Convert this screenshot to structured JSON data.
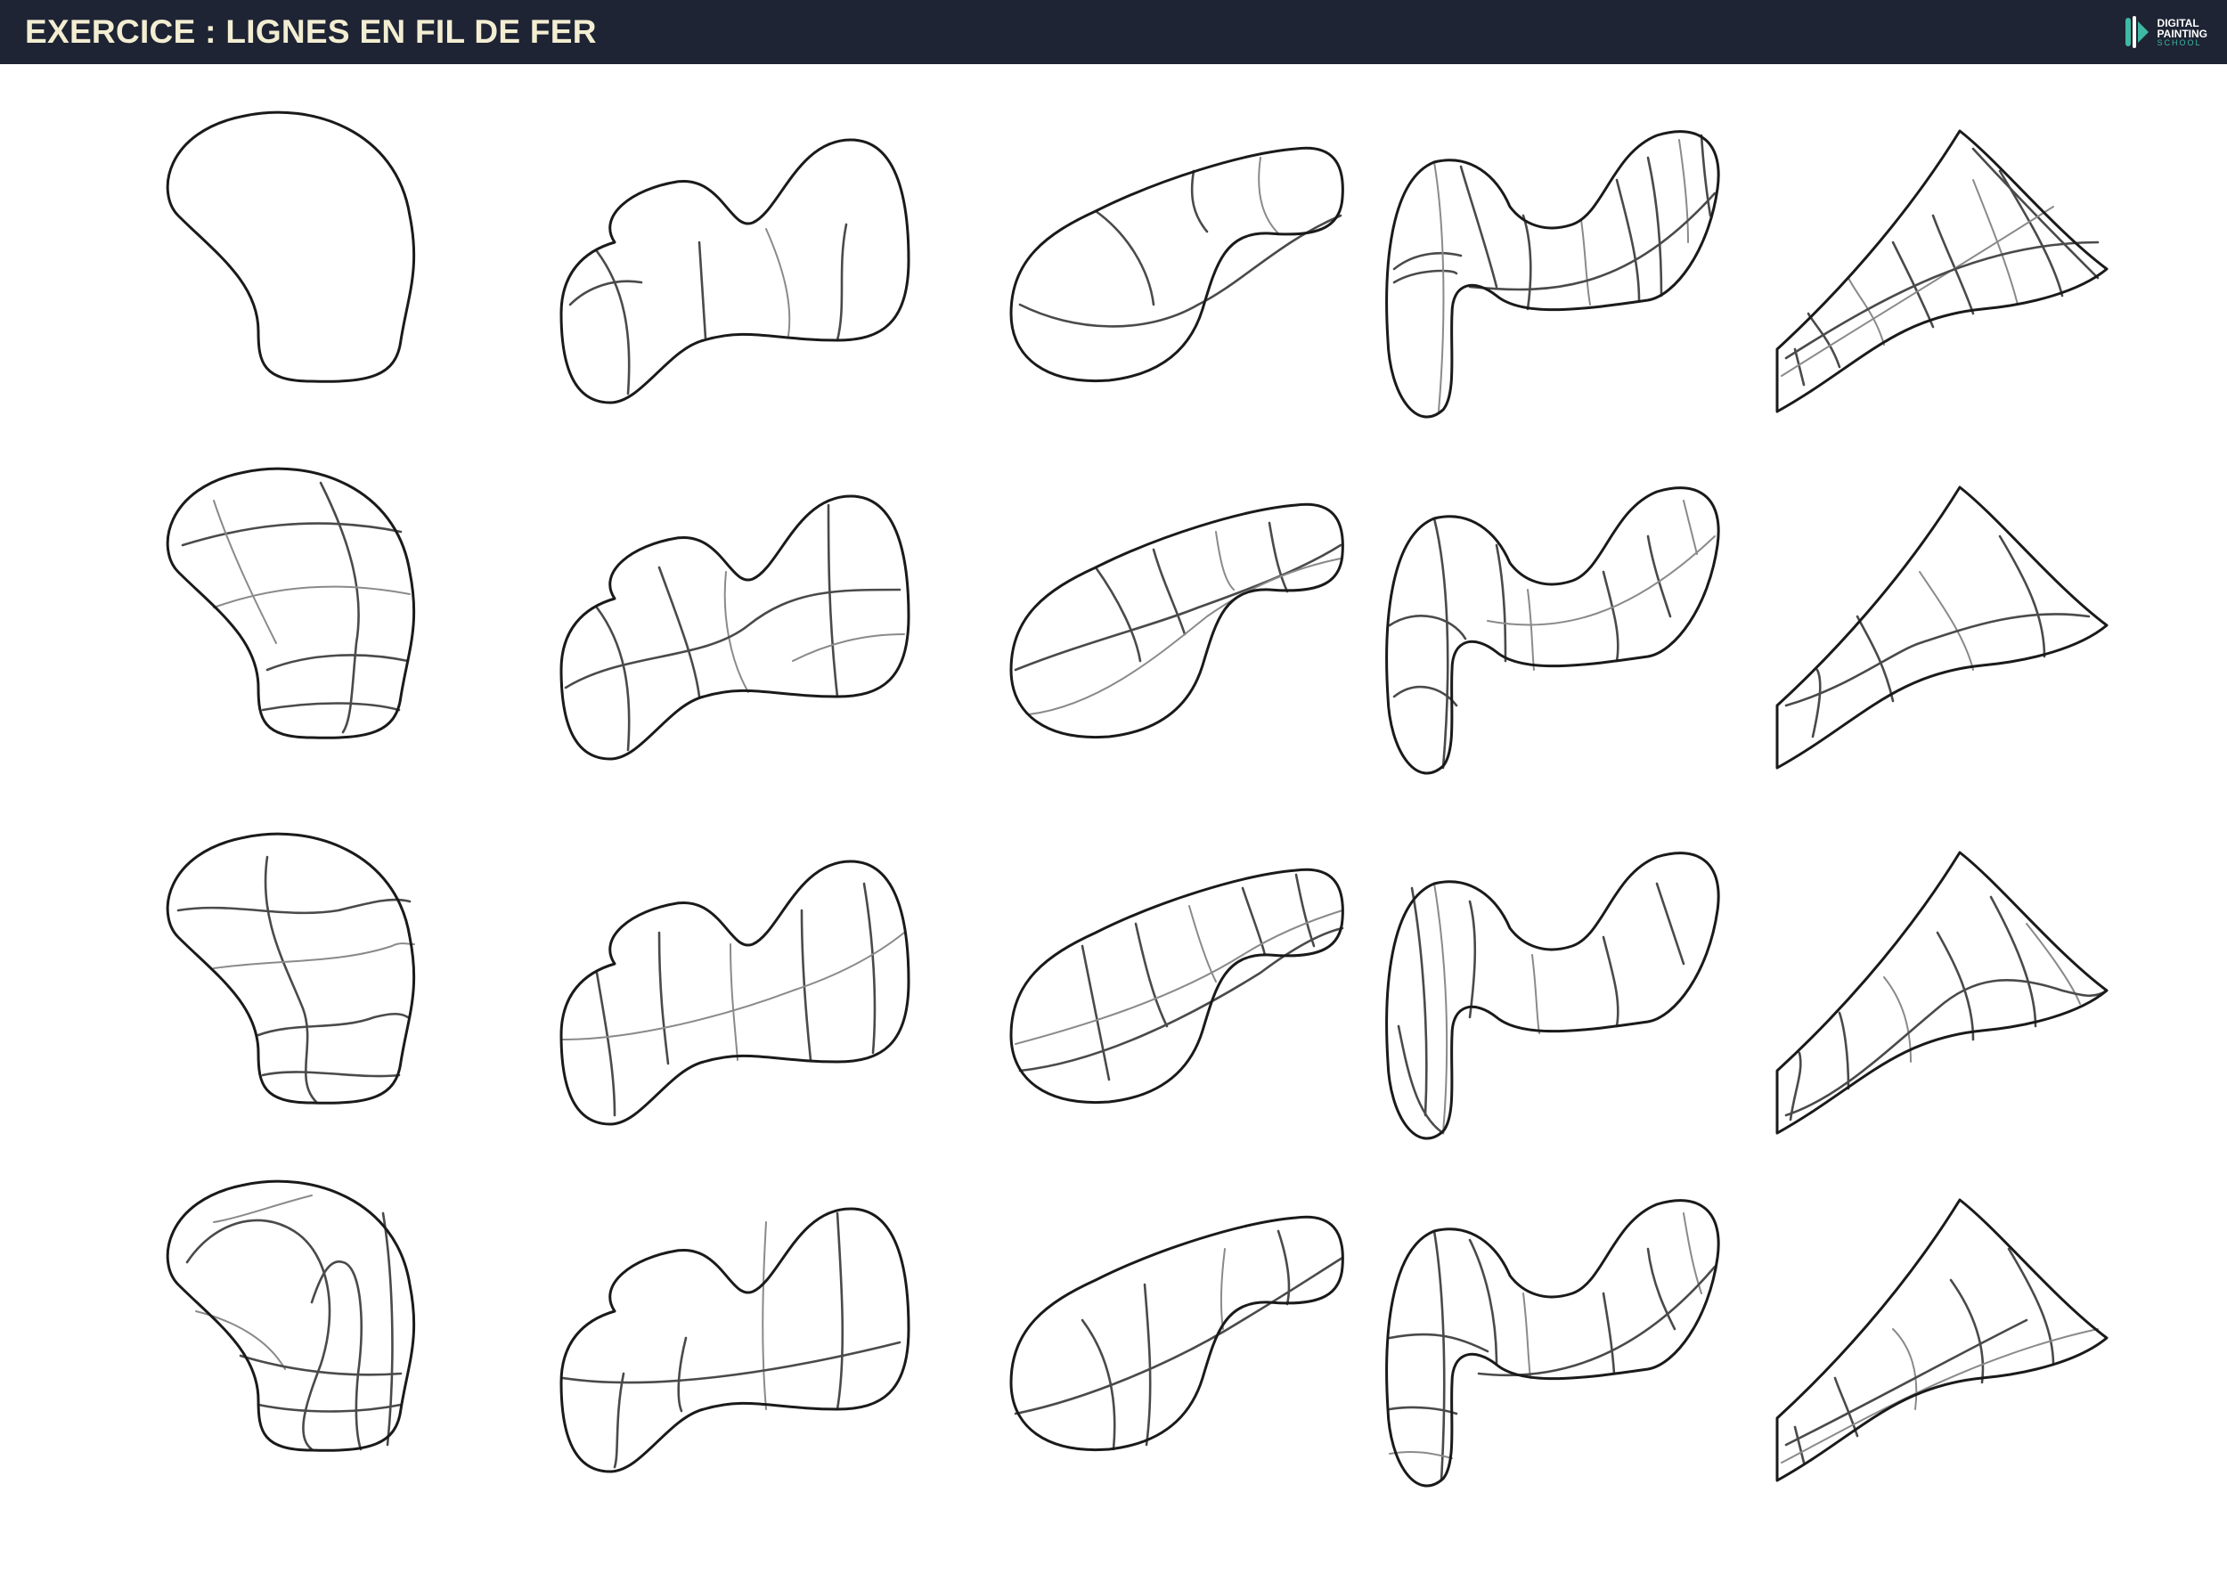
{
  "header": {
    "title": "EXERCICE : LIGNES EN FIL DE FER",
    "logo_line1": "DIGITAL",
    "logo_line2": "PAINTING",
    "logo_line3": "SCHOOL",
    "icon": "digital-painting-school-logo"
  },
  "colors": {
    "header_bg": "#1e2434",
    "title": "#f3eed2",
    "logo_accent": "#3fb9a6",
    "stroke": "#1a1a1a"
  },
  "sheet": {
    "rows": 4,
    "columns": 5
  }
}
